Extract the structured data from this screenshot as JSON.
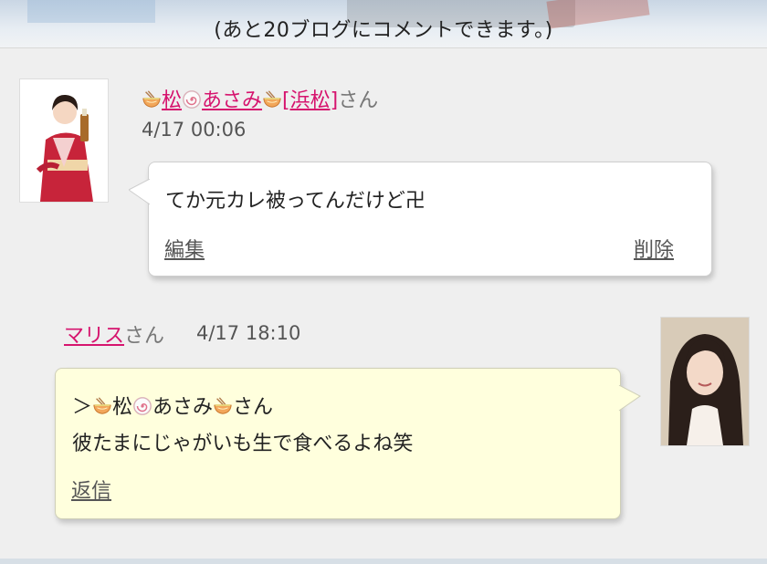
{
  "banner": {
    "text": "(あと20ブログにコメントできます。)"
  },
  "comments": [
    {
      "author_name": "松",
      "author_name_part2": "あさみ",
      "author_location": "[浜松]",
      "honorific": "さん",
      "date": "4/17 00:06",
      "text_lines": [
        "てか元カレ被ってんだけど卍"
      ],
      "actions": {
        "edit": "編集",
        "delete": "削除"
      }
    },
    {
      "author_name": "マリス",
      "honorific": "さん",
      "date": "4/17 18:10",
      "quote_prefix": "＞",
      "quote_name": "松",
      "quote_name_part2": "あさみ",
      "quote_honorific": "さん",
      "text_lines": [
        "彼たまにじゃがいも生で食べるよね笑"
      ],
      "actions": {
        "reply": "返信"
      }
    }
  ],
  "icons": {
    "noodle": "ramen-bowl-icon",
    "fishcake": "narutomaki-icon"
  },
  "colors": {
    "link": "#d6146e",
    "reply_bubble": "#ffffdd",
    "page_bg": "#efefef"
  }
}
